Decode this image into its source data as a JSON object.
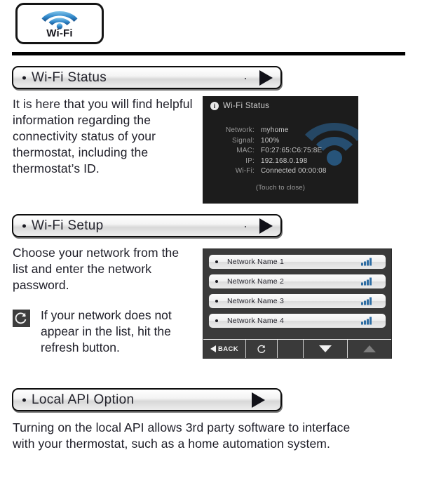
{
  "logo": {
    "label": "Wi-Fi",
    "icon": "wifi-icon"
  },
  "sections": [
    {
      "id": "status",
      "bullet": "•",
      "title": "Wi-Fi Status",
      "arrow_icon": "play-triangle-icon",
      "body": "It is here that you will find helpful information regarding the connectivity status of your thermostat, including the thermostat’s ID."
    },
    {
      "id": "setup",
      "bullet": "•",
      "title": "Wi-Fi Setup",
      "arrow_icon": "play-triangle-icon",
      "body": "Choose your network from the list and enter the network password.",
      "note": {
        "icon": "refresh-icon",
        "icon_glyph": "↻",
        "text": "If your network does not appear in the list, hit the refresh button."
      }
    },
    {
      "id": "api",
      "bullet": "•",
      "title": "Local API  Option",
      "arrow_icon": "play-triangle-icon",
      "body": "Turning on the local API allows 3rd party software to interface with your thermostat, such as a home automation system."
    }
  ],
  "status_panel": {
    "info_icon": "info-icon",
    "info_glyph": "i",
    "title": "Wi-Fi Status",
    "rows": [
      {
        "key": "Network:",
        "value": "myhome"
      },
      {
        "key": "Signal:",
        "value": "100%"
      },
      {
        "key": "MAC:",
        "value": "F0:27:65:C6:75:8E"
      },
      {
        "key": "IP:",
        "value": "192.168.0.198"
      },
      {
        "key": "Wi-Fi:",
        "value": "Connected 00:00:08"
      }
    ],
    "footer": "(Touch to close)",
    "background_color": "#1c1c1c",
    "wifi_glyph_color": "#2d6fa6"
  },
  "network_panel": {
    "networks": [
      {
        "name": "Network Name 1",
        "signal_icon": "signal-bars-icon"
      },
      {
        "name": "Network Name 2",
        "signal_icon": "signal-bars-icon"
      },
      {
        "name": "Network Name 3",
        "signal_icon": "signal-bars-icon"
      },
      {
        "name": "Network Name 4",
        "signal_icon": "signal-bars-icon"
      }
    ],
    "toolbar": {
      "back_label": "BACK",
      "back_icon": "back-triangle-icon",
      "refresh_icon": "refresh-icon",
      "refresh_glyph": "↻",
      "scroll_down_icon": "arrow-down-icon",
      "scroll_up_icon": "arrow-up-icon"
    },
    "accent_color": "#2f6ea4",
    "background_color": "#3a3a3a"
  }
}
